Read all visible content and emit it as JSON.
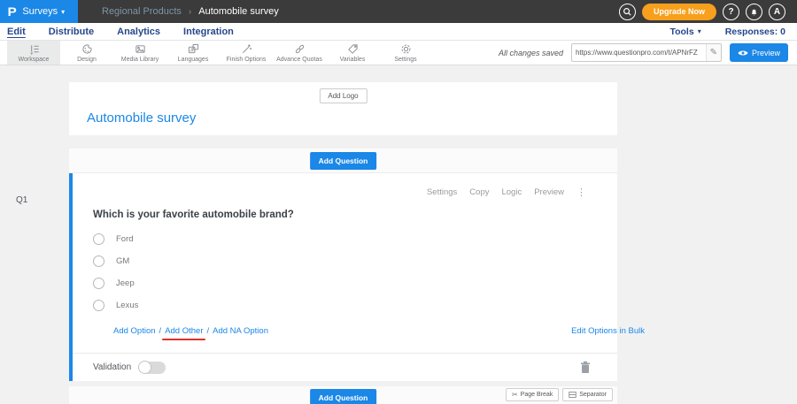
{
  "colors": {
    "accent_blue": "#1b87e6",
    "upgrade_orange": "#f7a01d",
    "topbar_dark": "#3b3b3b",
    "nav_navy": "#26478d",
    "red_annotation": "#e0312c"
  },
  "topbar": {
    "logo_letter": "P",
    "app_menu_label": "Surveys",
    "breadcrumb": {
      "parent": "Regional Products",
      "separator": "›",
      "current": "Automobile survey"
    },
    "upgrade_label": "Upgrade Now",
    "help_label": "?",
    "avatar_label": "A"
  },
  "subnav": {
    "tabs": [
      "Edit",
      "Distribute",
      "Analytics",
      "Integration"
    ],
    "tools_label": "Tools",
    "responses_label": "Responses: 0"
  },
  "toolbar": {
    "items": [
      {
        "label": "Workspace",
        "icon": "workspace-icon",
        "active": true
      },
      {
        "label": "Design",
        "icon": "design-icon"
      },
      {
        "label": "Media Library",
        "icon": "media-library-icon"
      },
      {
        "label": "Languages",
        "icon": "languages-icon"
      },
      {
        "label": "Finish Options",
        "icon": "finish-options-icon"
      },
      {
        "label": "Advance Quotas",
        "icon": "advance-quotas-icon"
      },
      {
        "label": "Variables",
        "icon": "variables-icon"
      },
      {
        "label": "Settings",
        "icon": "settings-icon"
      }
    ],
    "saved_status": "All changes saved",
    "url_value": "https://www.questionpro.com/t/APNrFZ",
    "preview_label": "Preview"
  },
  "survey": {
    "add_logo_label": "Add Logo",
    "title": "Automobile survey",
    "add_question_label": "Add Question",
    "question": {
      "id_label": "Q1",
      "actions": [
        "Settings",
        "Copy",
        "Logic",
        "Preview"
      ],
      "menu_dots": "⋮",
      "text": "Which is your favorite automobile brand?",
      "options": [
        "Ford",
        "GM",
        "Jeep",
        "Lexus"
      ],
      "add_links": [
        "Add Option",
        "Add Other",
        "Add NA Option"
      ],
      "add_links_separator": "/",
      "bulk_edit_label": "Edit Options in Bulk",
      "validation_label": "Validation",
      "validation_enabled": false
    },
    "page_break_label": "Page Break",
    "separator_label": "Separator"
  }
}
